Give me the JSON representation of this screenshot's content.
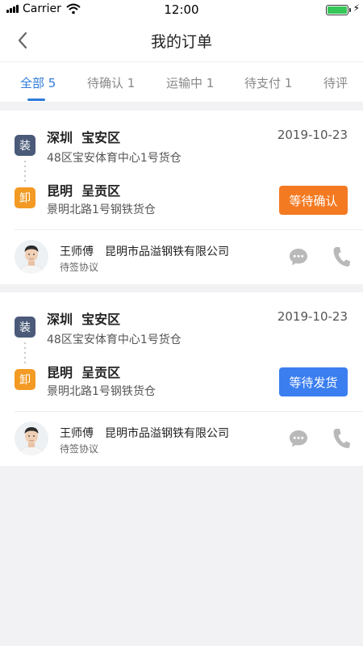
{
  "status_bar": {
    "carrier": "Carrier",
    "time": "12:00",
    "battery_level": 1.0
  },
  "nav": {
    "title": "我的订单",
    "back_icon": "chevron-left-icon"
  },
  "tabs": [
    {
      "label": "全部 5",
      "active": true
    },
    {
      "label": "待确认 1",
      "active": false
    },
    {
      "label": "运输中 1",
      "active": false
    },
    {
      "label": "待支付 1",
      "active": false
    },
    {
      "label": "待评",
      "active": false
    }
  ],
  "orders": [
    {
      "load_badge": "装",
      "unload_badge": "卸",
      "from_city": "深圳  宝安区",
      "from_address": "48区宝安体育中心1号货仓",
      "to_city": "昆明  呈贡区",
      "to_address": "景明北路1号钢铁货仓",
      "date": "2019-10-23",
      "status": "等待确认",
      "status_color": "#f47a22",
      "driver_name": "王师傅",
      "company": "昆明市品溢钢铁有限公司",
      "contract": "待签协议"
    },
    {
      "load_badge": "装",
      "unload_badge": "卸",
      "from_city": "深圳  宝安区",
      "from_address": "48区宝安体育中心1号货仓",
      "to_city": "昆明  呈贡区",
      "to_address": "景明北路1号钢铁货仓",
      "date": "2019-10-23",
      "status": "等待发货",
      "status_color": "#3b7ef0",
      "driver_name": "王师傅",
      "company": "昆明市品溢钢铁有限公司",
      "contract": "待签协议"
    }
  ],
  "colors": {
    "accent": "#2f7bd9",
    "load_badge": "#4a5a78",
    "unload_badge": "#f39a24"
  }
}
